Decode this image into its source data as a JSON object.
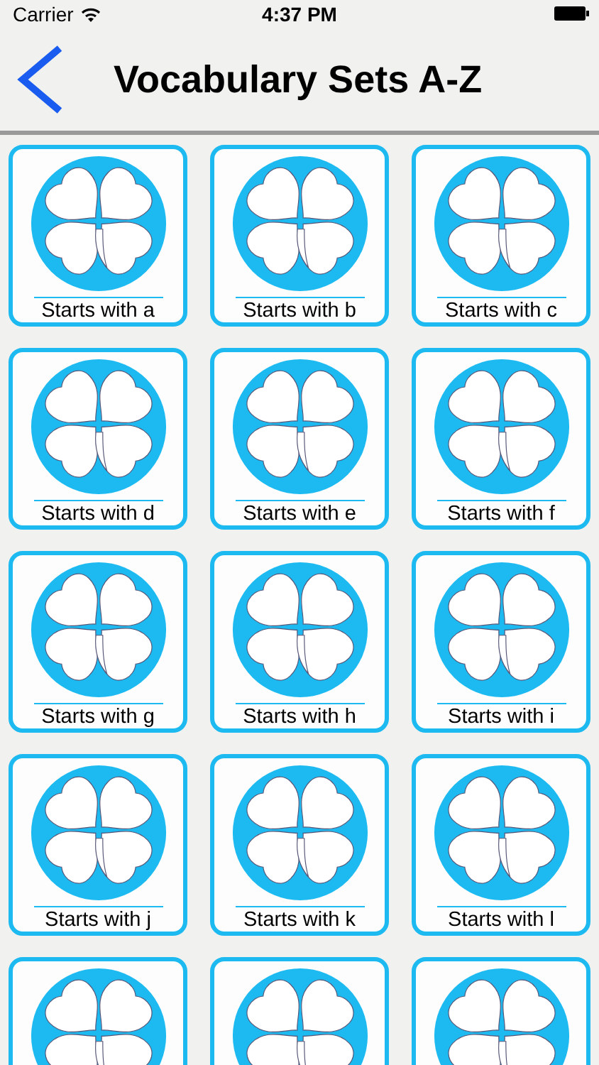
{
  "status_bar": {
    "carrier": "Carrier",
    "time": "4:37 PM"
  },
  "nav": {
    "title": "Vocabulary Sets A-Z"
  },
  "tiles": [
    {
      "kind": "labeled",
      "label": "Starts with a"
    },
    {
      "kind": "labeled",
      "label": "Starts with b"
    },
    {
      "kind": "labeled",
      "label": "Starts with c"
    },
    {
      "kind": "labeled",
      "label": "Starts with d"
    },
    {
      "kind": "labeled",
      "label": "Starts with e"
    },
    {
      "kind": "labeled",
      "label": "Starts with f"
    },
    {
      "kind": "labeled",
      "label": "Starts with g"
    },
    {
      "kind": "labeled",
      "label": "Starts with h"
    },
    {
      "kind": "labeled",
      "label": "Starts with i"
    },
    {
      "kind": "labeled",
      "label": "Starts with j"
    },
    {
      "kind": "labeled",
      "label": "Starts with k"
    },
    {
      "kind": "labeled",
      "label": "Starts with l"
    },
    {
      "kind": "cut_off"
    },
    {
      "kind": "cut_off"
    },
    {
      "kind": "cut_off"
    }
  ]
}
